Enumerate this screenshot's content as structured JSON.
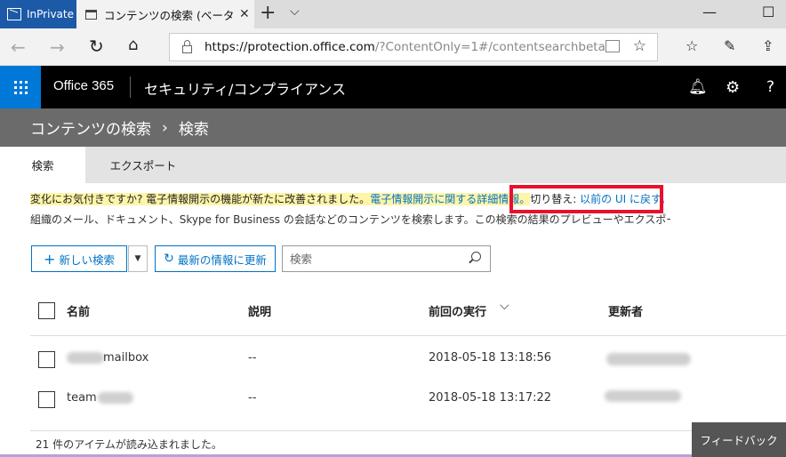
{
  "browser": {
    "inprivate_label": "InPrivate",
    "tab_title": "コンテンツの検索 (ベータ版)",
    "tab_close": "✕",
    "new_tab": "+",
    "tab_list": "⌵",
    "minimize": "—",
    "maximize": "☐",
    "url_host": "https://protection.office.com",
    "url_path": "/?ContentOnly=1#/contentsearchbeta"
  },
  "o365": {
    "brand": "Office 365",
    "app_name": "セキュリティ/コンプライアンス"
  },
  "breadcrumb": {
    "parent": "コンテンツの検索",
    "separator": "›",
    "current": "検索"
  },
  "tabs": [
    {
      "label": "検索",
      "active": true
    },
    {
      "label": "エクスポート",
      "active": false
    }
  ],
  "notice": {
    "highlight_text": "変化にお気付きですか? 電子情報開示の機能が新たに改善されました。",
    "link_text": "電子情報開示に関する詳細情報。",
    "switch_label": "切り替え: ",
    "switch_link": "以前の UI に戻す。",
    "description": "組織のメール、ドキュメント、Skype for Business の会話などのコンテンツを検索します。この検索の結果のプレビューやエクスポートができます。"
  },
  "toolbar": {
    "new_search": "新しい検索",
    "refresh": "最新の情報に更新",
    "search_placeholder": "検索"
  },
  "table": {
    "columns": [
      "名前",
      "説明",
      "前回の実行",
      "更新者"
    ],
    "rows": [
      {
        "name": "mailbox",
        "description": "--",
        "last_run": "2018-05-18 13:18:56"
      },
      {
        "name": "team",
        "description": "--",
        "last_run": "2018-05-18 13:17:22"
      }
    ]
  },
  "status": "21 件のアイテムが読み込まれました。",
  "feedback": "フィードバック",
  "colors": {
    "accent": "#0078d7",
    "link": "#0072c6",
    "highlight": "#fff5a8",
    "red_box": "#e8112d"
  }
}
